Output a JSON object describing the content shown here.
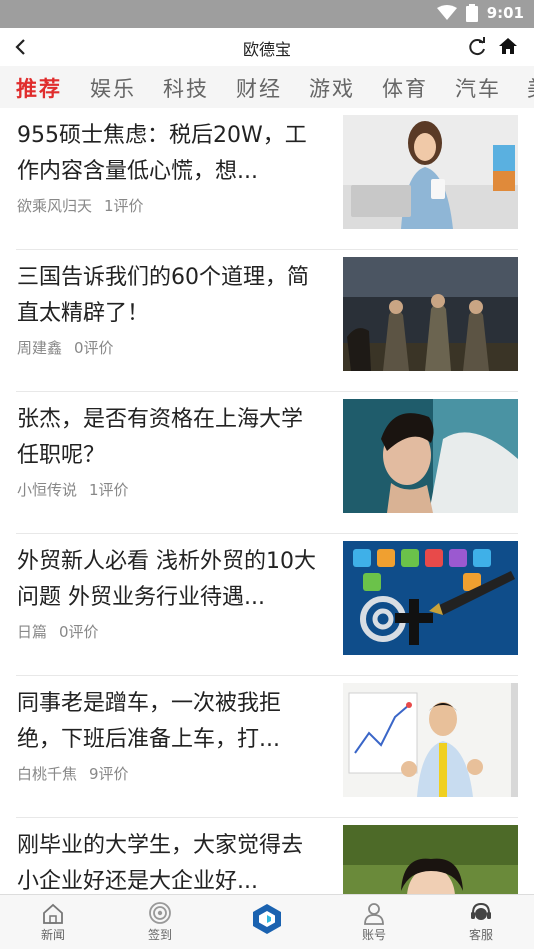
{
  "status_bar": {
    "time": "9:01",
    "icons": [
      "wifi-icon",
      "battery-icon"
    ]
  },
  "top_bar": {
    "title": "欧德宝",
    "back_icon": "back-icon",
    "refresh_icon": "refresh-icon",
    "home_icon": "home-icon"
  },
  "tabs": [
    "推荐",
    "娱乐",
    "科技",
    "财经",
    "游戏",
    "体育",
    "汽车",
    "美"
  ],
  "active_tab_index": 0,
  "colors": {
    "accent": "#e02d2d",
    "status_bar": "#9e9e9e",
    "tab_bar": "#f5f5f5",
    "meta_text": "#888888",
    "nav_active": "#1a62b0"
  },
  "articles": [
    {
      "title": "955硕士焦虑：税后20W，工作内容含量低心慌，想...",
      "author": "欲乘风归天",
      "comments": "1评价"
    },
    {
      "title": "三国告诉我们的60个道理，简直太精辟了！",
      "author": "周建鑫",
      "comments": "0评价"
    },
    {
      "title": "张杰，是否有资格在上海大学任职呢？",
      "author": "小恒传说",
      "comments": "1评价"
    },
    {
      "title": "外贸新人必看 浅析外贸的10大问题 外贸业务行业待遇...",
      "author": "日篇",
      "comments": "0评价"
    },
    {
      "title": "同事老是蹭车，一次被我拒绝，下班后准备上车，打...",
      "author": "白桃千焦",
      "comments": "9评价"
    },
    {
      "title": "刚毕业的大学生，大家觉得去小企业好还是大企业好...",
      "author": "",
      "comments": ""
    }
  ],
  "bottom_nav": [
    {
      "label": "新闻",
      "icon": "news-icon"
    },
    {
      "label": "签到",
      "icon": "checkin-icon"
    },
    {
      "label": "",
      "icon": "app-logo-icon"
    },
    {
      "label": "账号",
      "icon": "account-icon"
    },
    {
      "label": "客服",
      "icon": "customer-service-icon"
    }
  ]
}
